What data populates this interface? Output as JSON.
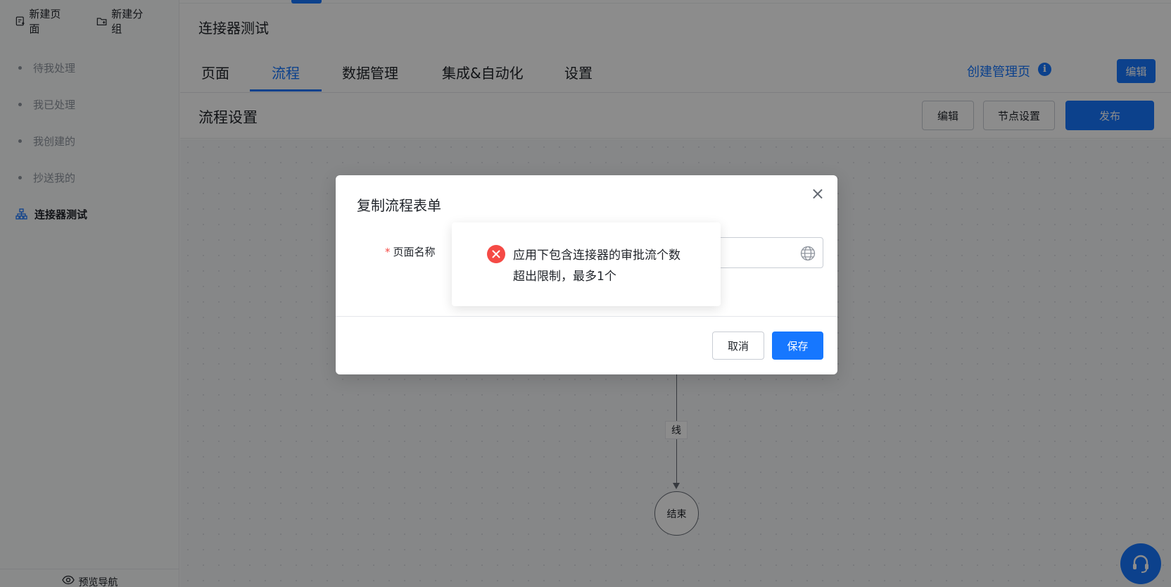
{
  "sidebar": {
    "new_page": "新建页面",
    "new_group": "新建分组",
    "items": [
      {
        "label": "待我处理"
      },
      {
        "label": "我已处理"
      },
      {
        "label": "我创建的"
      },
      {
        "label": "抄送我的"
      }
    ],
    "active_item": "连接器测试",
    "preview_nav": "预览导航"
  },
  "header": {
    "app_title": "连接器测试",
    "tabs": [
      {
        "label": "页面"
      },
      {
        "label": "流程"
      },
      {
        "label": "数据管理"
      },
      {
        "label": "集成&自动化"
      },
      {
        "label": "设置"
      }
    ],
    "active_tab": "流程",
    "create_admin_page": "创建管理页",
    "info_icon": "i",
    "edit": "编辑"
  },
  "subheader": {
    "title": "流程设置",
    "edit": "编辑",
    "node_settings": "节点设置",
    "publish": "发布"
  },
  "canvas": {
    "line_label": "线",
    "end_node": "结束"
  },
  "modal": {
    "title": "复制流程表单",
    "close": "×",
    "required_mark": "*",
    "field_label": "页面名称",
    "field_value": "",
    "cancel": "取消",
    "save": "保存"
  },
  "toast": {
    "message": "应用下包含连接器的审批流个数超出限制，最多1个"
  },
  "colors": {
    "primary": "#1677ff",
    "error": "#f54a45"
  }
}
